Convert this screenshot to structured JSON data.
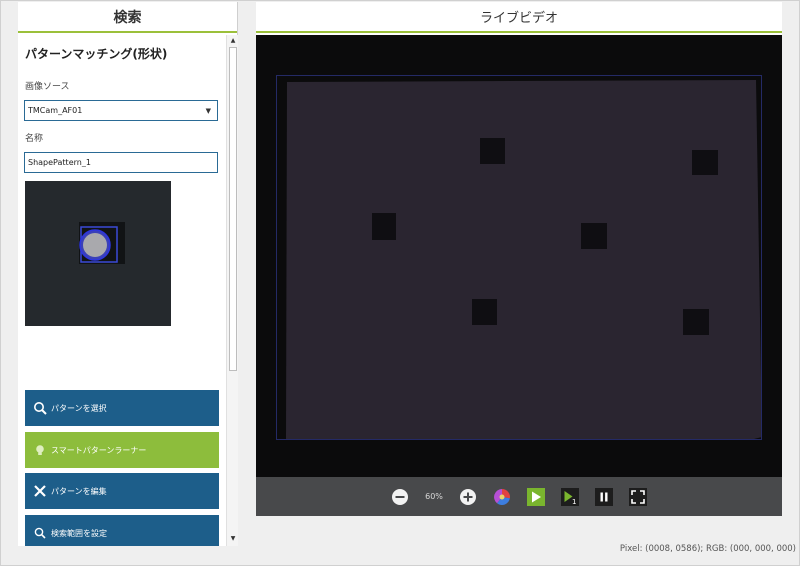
{
  "left_panel": {
    "title": "検索",
    "section_title": "パターンマッチング(形状)",
    "image_source_label": "画像ソース",
    "image_source_value": "TMCam_AF01",
    "name_label": "名称",
    "name_value": "ShapePattern_1",
    "buttons": [
      {
        "label": "パターンを選択",
        "icon": "search-pattern-icon"
      },
      {
        "label": "スマートパターンラーナー",
        "icon": "lightbulb-icon"
      },
      {
        "label": "パターンを編集",
        "icon": "edit-pattern-icon"
      },
      {
        "label": "検索範囲を設定",
        "icon": "search-icon"
      }
    ]
  },
  "right_panel": {
    "title": "ライブビデオ",
    "toolbar": {
      "zoom_level": "60%",
      "icons": [
        "zoom-out-icon",
        "zoom-in-icon",
        "color-wheel-icon",
        "play-icon",
        "step-play-icon",
        "pause-icon",
        "fullscreen-icon"
      ]
    }
  },
  "status": {
    "text": "Pixel: (0008, 0586); RGB: (000, 000, 000)"
  },
  "colors": {
    "accent_green": "#9bc03a",
    "button_blue": "#1d5e8a",
    "button_green": "#8dbd3c",
    "toolbar_bg": "#48494b"
  }
}
